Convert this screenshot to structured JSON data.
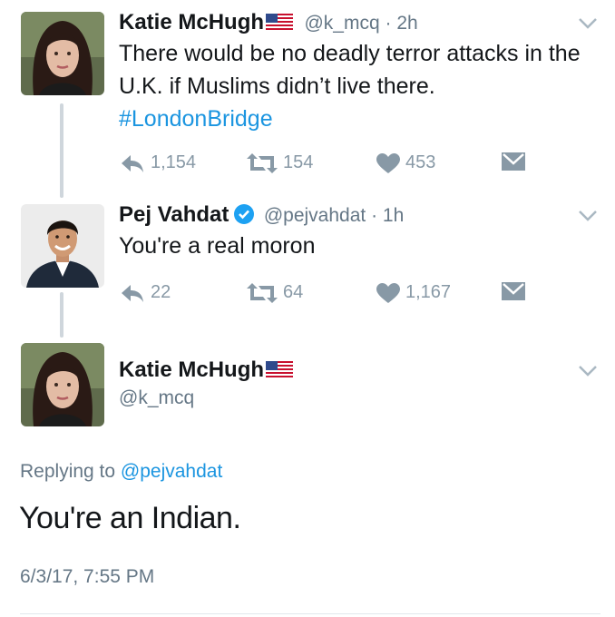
{
  "tweets": [
    {
      "name": "Katie McHugh",
      "handle": "@k_mcq",
      "time": "2h",
      "text": "There would be no deadly terror attacks in the U.K. if Muslims didn’t live there.",
      "hashtag": "#LondonBridge",
      "replies": "1,154",
      "retweets": "154",
      "likes": "453"
    },
    {
      "name": "Pej Vahdat",
      "handle": "@pejvahdat",
      "time": "1h",
      "text": "You're a real moron",
      "replies": "22",
      "retweets": "64",
      "likes": "1,167"
    }
  ],
  "focused": {
    "name": "Katie McHugh",
    "handle": "@k_mcq",
    "replying_prefix": "Replying to",
    "replying_to": "@pejvahdat",
    "text": "You're an Indian.",
    "timestamp": "6/3/17, 7:55 PM"
  },
  "icons": {
    "reply": "reply-icon",
    "retweet": "retweet-icon",
    "like": "heart-icon",
    "dm": "envelope-icon",
    "menu": "chevron-down-icon",
    "flag": "us-flag-icon",
    "verified": "verified-badge-icon"
  },
  "colors": {
    "link": "#1b95e0",
    "muted": "#8899a6",
    "verified": "#1da1f2"
  }
}
